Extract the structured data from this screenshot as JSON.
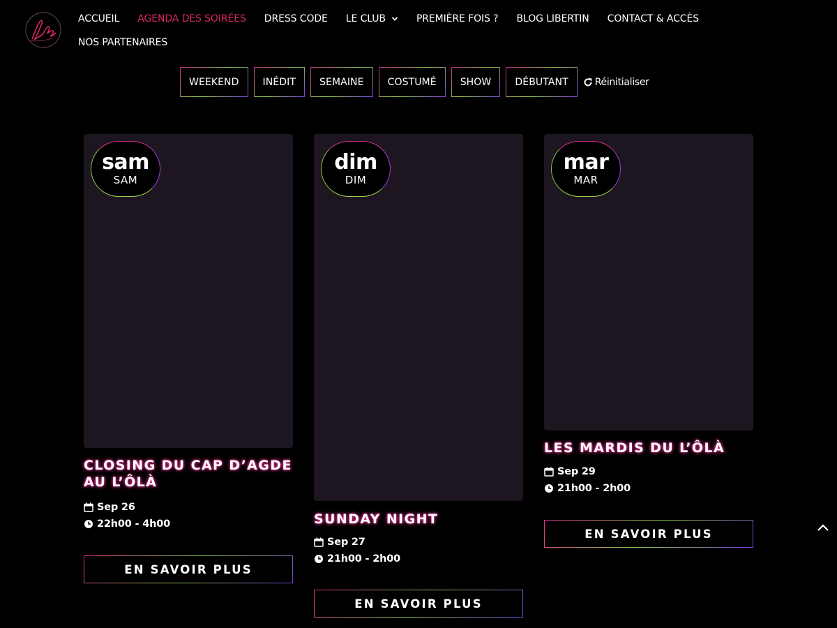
{
  "nav": {
    "row1": [
      "ACCUEIL",
      "AGENDA DES SOIRÉES",
      "DRESS CODE",
      "LE CLUB",
      "PREMIÈRE FOIS ?",
      "BLOG LIBERTIN",
      "CONTACT & ACCÈS"
    ],
    "row2": [
      "NOS PARTENAIRES"
    ],
    "active_index": 1,
    "dropdown_index": 3
  },
  "filters": {
    "buttons": [
      "WEEKEND",
      "INÉDIT",
      "SEMAINE",
      "COSTUMÉ",
      "SHOW",
      "DÉBUTANT"
    ],
    "reset_label": "Réinitialiser"
  },
  "events": [
    {
      "day_short": "sam",
      "day_label": "SAM",
      "title": "CLOSING DU CAP D’AGDE AU L’ÔLÀ",
      "date": "Sep 26",
      "time": "22h00 - 4h00",
      "cta": "EN SAVOIR PLUS"
    },
    {
      "day_short": "dim",
      "day_label": "DIM",
      "title": "SUNDAY NIGHT",
      "date": "Sep 27",
      "time": "21h00 - 2h00",
      "cta": "EN SAVOIR PLUS"
    },
    {
      "day_short": "mar",
      "day_label": "MAR",
      "title": "LES MARDIS DU L’ÔLÀ",
      "date": "Sep 29",
      "time": "21h00 - 2h00",
      "cta": "EN SAVOIR PLUS"
    }
  ],
  "colors": {
    "accent": "#d8285f",
    "card_bg": "#1d1620",
    "glow": "#e0308e"
  },
  "icons": {
    "calendar": "calendar-icon",
    "clock": "clock-icon",
    "reset": "refresh-icon",
    "back_to_top": "chevron-up-icon"
  }
}
